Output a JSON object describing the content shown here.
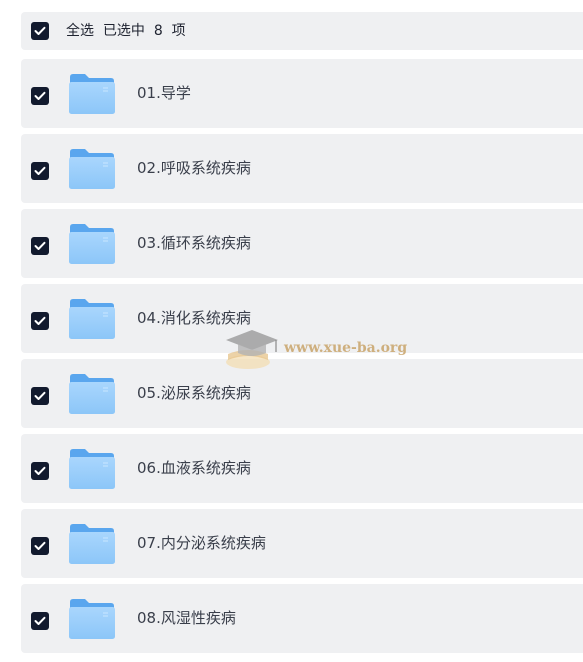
{
  "select_all": {
    "label": "全选",
    "selected_text": "已选中",
    "count": "8",
    "unit": "项",
    "checked": true
  },
  "folders": [
    {
      "label": "01.导学",
      "checked": true
    },
    {
      "label": "02.呼吸系统疾病",
      "checked": true
    },
    {
      "label": "03.循环系统疾病",
      "checked": true
    },
    {
      "label": "04.消化系统疾病",
      "checked": true
    },
    {
      "label": "05.泌尿系统疾病",
      "checked": true
    },
    {
      "label": "06.血液系统疾病",
      "checked": true
    },
    {
      "label": "07.内分泌系统疾病",
      "checked": true
    },
    {
      "label": "08.风湿性疾病",
      "checked": true
    }
  ],
  "watermark": {
    "text": "www.xue-ba.org"
  },
  "colors": {
    "row_bg": "#eff0f2",
    "checkbox": "#121a2e",
    "folder_back": "#5aa6ee",
    "folder_front": "#9fd0fb"
  }
}
